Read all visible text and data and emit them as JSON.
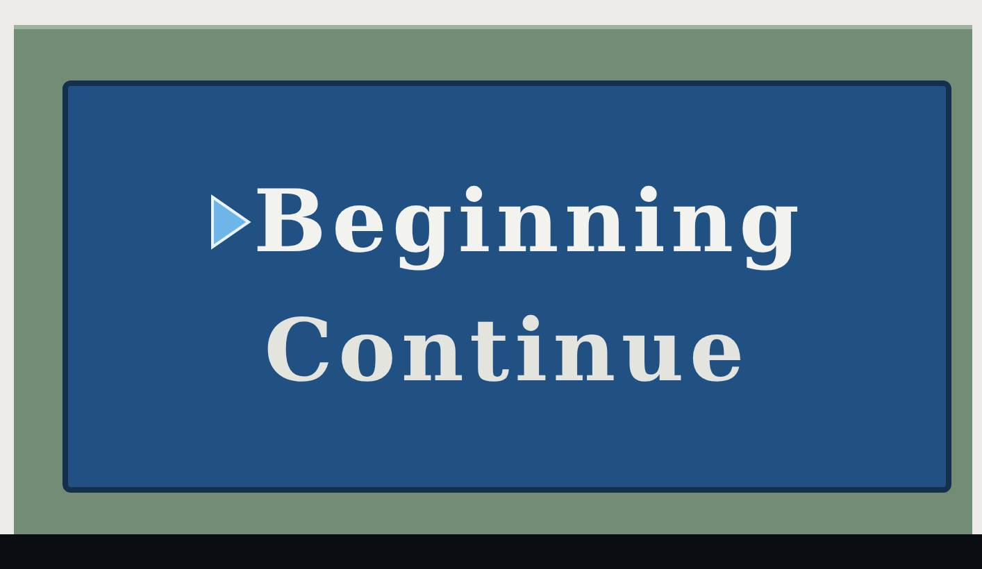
{
  "menu": {
    "items": [
      {
        "label": "Beginning",
        "selected": true
      },
      {
        "label": "Continue",
        "selected": false
      }
    ]
  }
}
